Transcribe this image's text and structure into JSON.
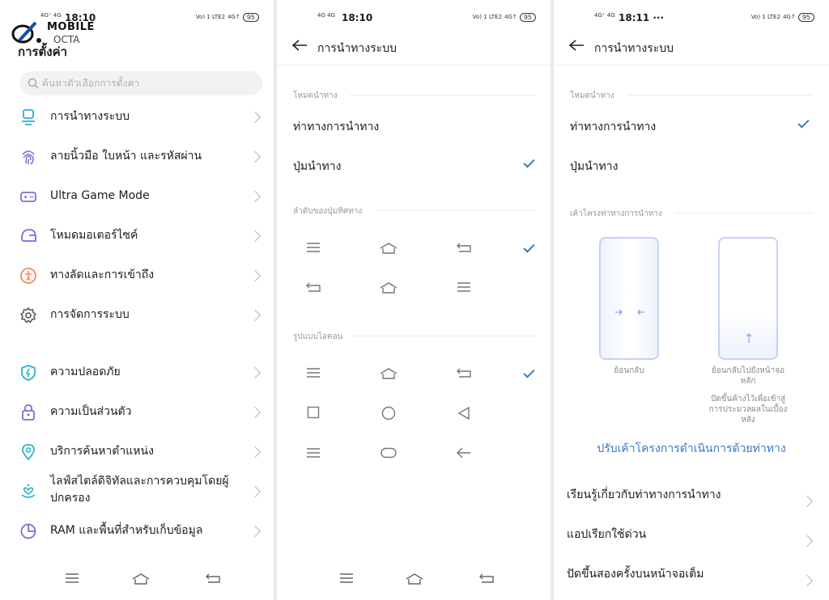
{
  "status_left": {
    "time": "18:10",
    "signal": "4G⁺ 4G"
  },
  "status_mid": {
    "time": "18:10",
    "signal": "4G 4G"
  },
  "status_right": {
    "time": "18:11 ···",
    "signal": "4G⁺ 4G"
  },
  "status_icons": {
    "volte": "Vo) 1 LTE2",
    "sim": "4G↑",
    "battery": "95"
  },
  "logo": {
    "line1": "MOBILE",
    "line2": "OCTA"
  },
  "settings": {
    "title": "การตั้งค่า",
    "search_placeholder": "ค้นหาตัวเลือกการตั้งค่า",
    "group1": [
      {
        "label": "การนำทางระบบ",
        "icon": "navigation-icon"
      },
      {
        "label": "ลายนิ้วมือ ใบหน้า และรหัสผ่าน",
        "icon": "fingerprint-icon"
      },
      {
        "label": "Ultra Game Mode",
        "icon": "gamepad-icon"
      },
      {
        "label": "โหมดมอเตอร์ไซค์",
        "icon": "helmet-icon"
      },
      {
        "label": "ทางลัดและการเข้าถึง",
        "icon": "accessibility-icon"
      },
      {
        "label": "การจัดการระบบ",
        "icon": "gear-icon"
      }
    ],
    "group2": [
      {
        "label": "ความปลอดภัย",
        "icon": "shield-icon"
      },
      {
        "label": "ความเป็นส่วนตัว",
        "icon": "lock-icon"
      },
      {
        "label": "บริการค้นหาตำแหน่ง",
        "icon": "location-pin-icon"
      },
      {
        "label": "ไลฟ์สไตล์ดิจิทัลและการควบคุมโดยผู้ปกครอง",
        "icon": "heart-hand-icon"
      },
      {
        "label": "RAM และพื้นที่สำหรับเก็บข้อมูล",
        "icon": "pie-chart-icon"
      }
    ]
  },
  "nav_mid": {
    "title": "การนำทางระบบ",
    "mode_section": "โหมดนำทาง",
    "option_gestures": "ท่าทางการนำทาง",
    "option_buttons": "ปุ่มนำทาง",
    "order_section": "ลำดับของปุ่มทิศทาง",
    "style_section": "รูปแบบไอคอน"
  },
  "nav_right": {
    "title": "การนำทางระบบ",
    "mode_section": "โหมดนำทาง",
    "option_gestures": "ท่าทางการนำทาง",
    "option_buttons": "ปุ่มนำทาง",
    "layout_section": "เค้าโครงท่าทางการนำทาง",
    "caption_back": "ย้อนกลับ",
    "caption_home": "ย้อนกลับไปยังหน้าจอหลัก",
    "caption_recent": "ปัดขึ้นค้างไว้เพื่อเข้าสู่การประมวลผลในเบื้องหลัง",
    "adjust_link": "ปรับเค้าโครงการดำเนินการด้วยท่าทาง",
    "more": [
      "เรียนรู้เกี่ยวกับท่าทางการนำทาง",
      "แอปเรียกใช้ด่วน",
      "ปัดขึ้นสองครั้งบนหน้าจอเต็ม"
    ]
  },
  "colors": {
    "accent": "#3b78c6",
    "icon_teal": "#2ab3c6",
    "icon_purple": "#7b6fd6",
    "icon_orange": "#f08a4b"
  }
}
